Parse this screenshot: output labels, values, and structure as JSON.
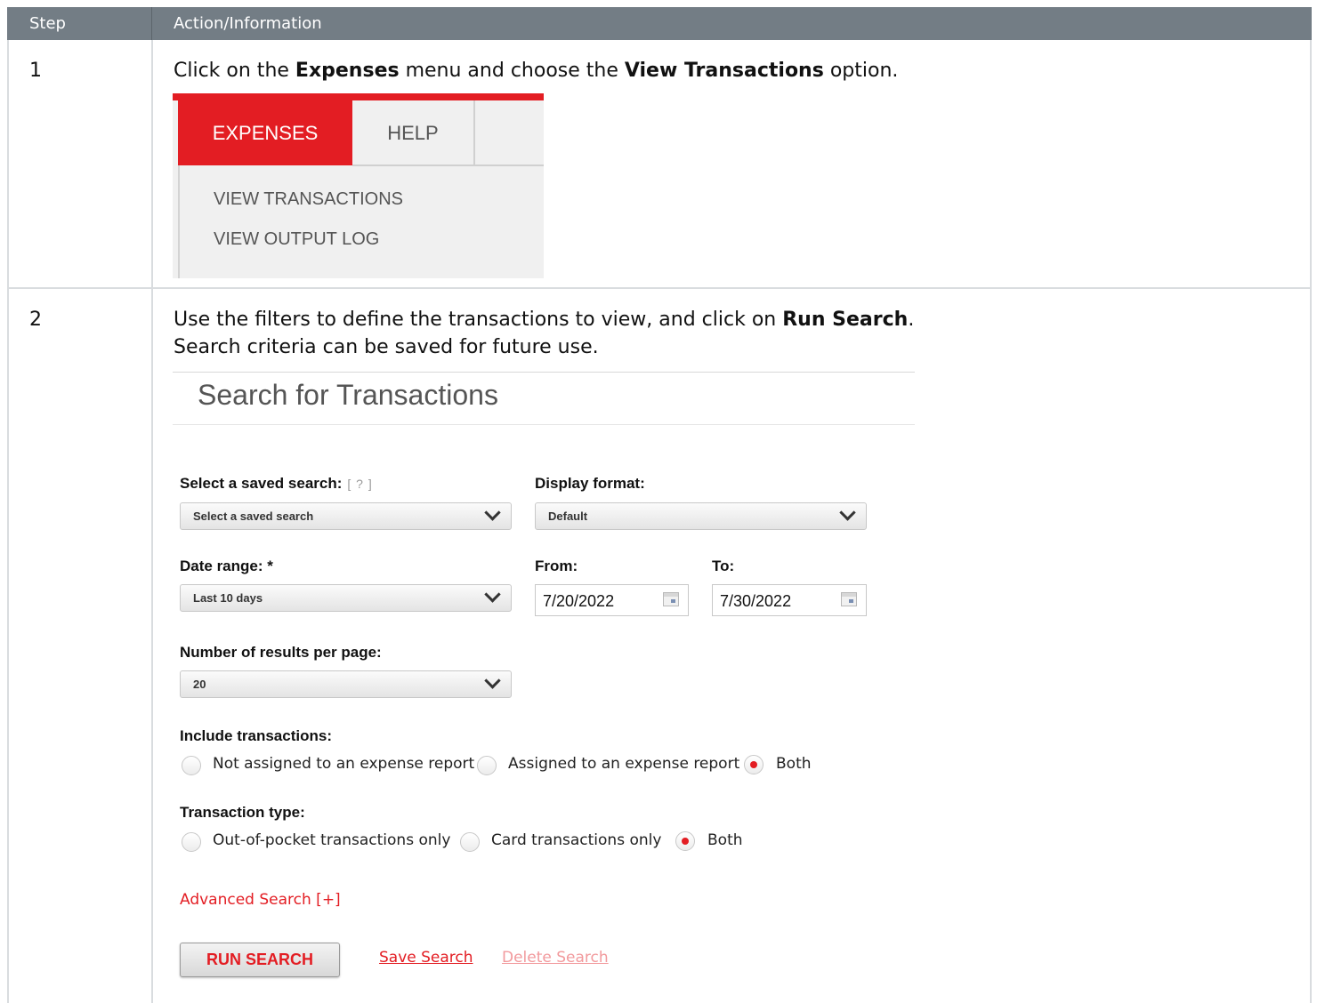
{
  "table": {
    "headers": [
      "Step",
      "Action/Information"
    ],
    "rows": [
      {
        "step": "1",
        "instruction_parts": [
          "Click on the ",
          "Expenses",
          " menu and choose the ",
          "View Transactions",
          " option."
        ]
      },
      {
        "step": "2",
        "instruction_parts": [
          "Use the filters to define the transactions to view, and click on ",
          "Run Search",
          "."
        ],
        "instruction_line2": "Search criteria can be saved for future use."
      }
    ]
  },
  "menu": {
    "tabs": [
      "EXPENSES",
      "HELP"
    ],
    "items": [
      "VIEW TRANSACTIONS",
      "VIEW OUTPUT LOG"
    ],
    "accent": "#e31d23"
  },
  "search": {
    "title": "Search for Transactions",
    "saved_search_label": "Select a saved search:",
    "saved_search_help": "[ ? ]",
    "saved_search_value": "Select a saved search",
    "display_format_label": "Display format:",
    "display_format_value": "Default",
    "date_range_label": "Date range: *",
    "date_range_value": "Last 10 days",
    "from_label": "From:",
    "from_value": "7/20/2022",
    "to_label": "To:",
    "to_value": "7/30/2022",
    "results_label": "Number of results per page:",
    "results_value": "20",
    "include_label": "Include transactions:",
    "include_options": [
      "Not assigned to an expense report",
      "Assigned to an expense report",
      "Both"
    ],
    "include_selected": "Both",
    "type_label": "Transaction type:",
    "type_options": [
      "Out-of-pocket transactions only",
      "Card transactions only",
      "Both"
    ],
    "type_selected": "Both",
    "advanced_link": "Advanced Search [+]",
    "run_button": "RUN SEARCH",
    "save_link": "Save Search",
    "delete_link": "Delete Search",
    "colors": {
      "header_bg": "#737d85",
      "accent_red": "#e31d23",
      "disabled_link": "#f29a9d"
    }
  }
}
